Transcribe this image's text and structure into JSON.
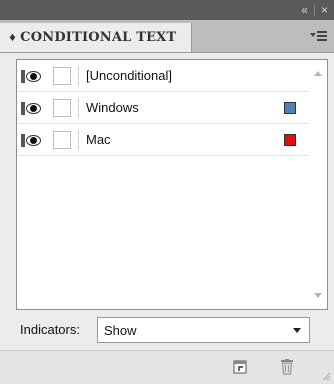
{
  "panel": {
    "title": "CONDITIONAL TEXT",
    "tab_arrow": "♦"
  },
  "conditions": [
    {
      "label": "[Unconditional]",
      "visible": true,
      "color": null
    },
    {
      "label": "Windows",
      "visible": true,
      "color": "#4f81bd"
    },
    {
      "label": "Mac",
      "visible": true,
      "color": "#e01010"
    }
  ],
  "indicators": {
    "label": "Indicators:",
    "value": "Show"
  },
  "icons": [
    "collapse-icon",
    "close-icon",
    "panel-menu-icon",
    "eye-icon",
    "new-condition-icon",
    "delete-icon",
    "resize-grip-icon"
  ]
}
